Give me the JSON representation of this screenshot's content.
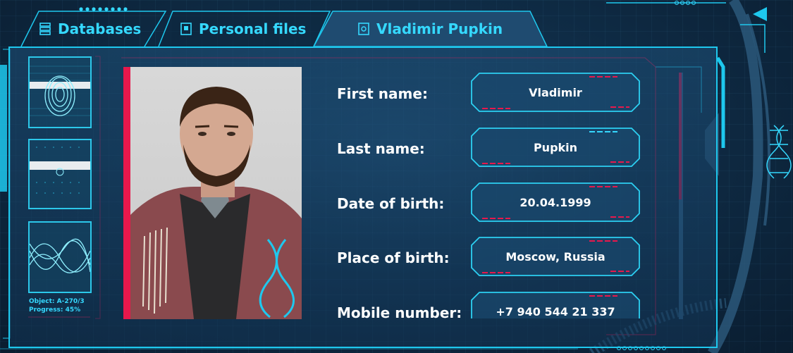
{
  "tabs": [
    {
      "label": "Databases",
      "icon": "database-icon",
      "active": false
    },
    {
      "label": "Personal files",
      "icon": "document-icon",
      "active": false
    },
    {
      "label": "Vladimir Pupkin",
      "icon": "profile-file-icon",
      "active": true
    }
  ],
  "scan": {
    "object_label": "Object: A-270/3",
    "progress_label": "Progress: 45%",
    "progress": 0.45
  },
  "profile": {
    "fields": [
      {
        "label": "First name:",
        "value": "Vladimir"
      },
      {
        "label": "Last name:",
        "value": "Pupkin"
      },
      {
        "label": "Date of birth:",
        "value": "20.04.1999"
      },
      {
        "label": "Place of birth:",
        "value": "Moscow, Russia"
      },
      {
        "label": "Mobile number:",
        "value": "+7 940 544 21 337"
      }
    ]
  },
  "colors": {
    "accent": "#35d9ff",
    "alert": "#e8184c",
    "panel": "#17405f"
  }
}
